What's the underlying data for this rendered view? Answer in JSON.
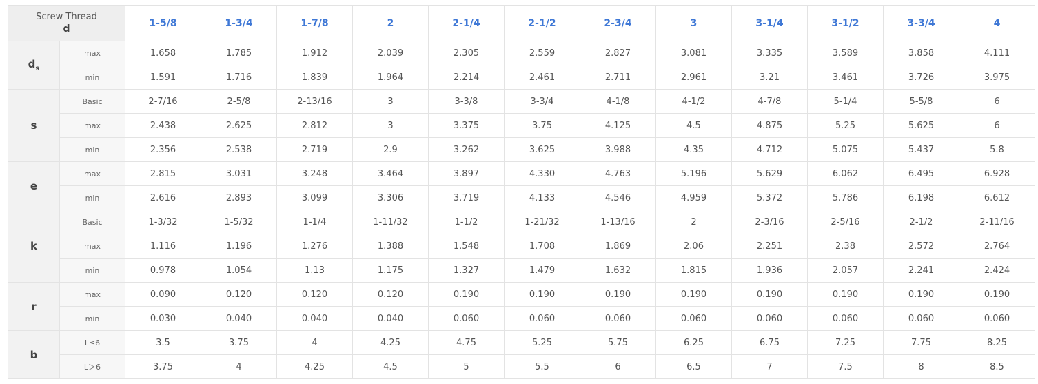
{
  "header": {
    "corner_line1": "Screw Thread",
    "corner_line2": "d",
    "sizes": [
      "1-5/8",
      "1-3/4",
      "1-7/8",
      "2",
      "2-1/4",
      "2-1/2",
      "2-3/4",
      "3",
      "3-1/4",
      "3-1/2",
      "3-3/4",
      "4"
    ]
  },
  "groups": [
    {
      "param": "d",
      "param_sub": "s",
      "rows": [
        {
          "label": "max",
          "values": [
            "1.658",
            "1.785",
            "1.912",
            "2.039",
            "2.305",
            "2.559",
            "2.827",
            "3.081",
            "3.335",
            "3.589",
            "3.858",
            "4.111"
          ]
        },
        {
          "label": "min",
          "values": [
            "1.591",
            "1.716",
            "1.839",
            "1.964",
            "2.214",
            "2.461",
            "2.711",
            "2.961",
            "3.21",
            "3.461",
            "3.726",
            "3.975"
          ]
        }
      ]
    },
    {
      "param": "s",
      "param_sub": "",
      "rows": [
        {
          "label": "Basic",
          "values": [
            "2-7/16",
            "2-5/8",
            "2-13/16",
            "3",
            "3-3/8",
            "3-3/4",
            "4-1/8",
            "4-1/2",
            "4-7/8",
            "5-1/4",
            "5-5/8",
            "6"
          ]
        },
        {
          "label": "max",
          "values": [
            "2.438",
            "2.625",
            "2.812",
            "3",
            "3.375",
            "3.75",
            "4.125",
            "4.5",
            "4.875",
            "5.25",
            "5.625",
            "6"
          ]
        },
        {
          "label": "min",
          "values": [
            "2.356",
            "2.538",
            "2.719",
            "2.9",
            "3.262",
            "3.625",
            "3.988",
            "4.35",
            "4.712",
            "5.075",
            "5.437",
            "5.8"
          ]
        }
      ]
    },
    {
      "param": "e",
      "param_sub": "",
      "rows": [
        {
          "label": "max",
          "values": [
            "2.815",
            "3.031",
            "3.248",
            "3.464",
            "3.897",
            "4.330",
            "4.763",
            "5.196",
            "5.629",
            "6.062",
            "6.495",
            "6.928"
          ]
        },
        {
          "label": "min",
          "values": [
            "2.616",
            "2.893",
            "3.099",
            "3.306",
            "3.719",
            "4.133",
            "4.546",
            "4.959",
            "5.372",
            "5.786",
            "6.198",
            "6.612"
          ]
        }
      ]
    },
    {
      "param": "k",
      "param_sub": "",
      "rows": [
        {
          "label": "Basic",
          "values": [
            "1-3/32",
            "1-5/32",
            "1-1/4",
            "1-11/32",
            "1-1/2",
            "1-21/32",
            "1-13/16",
            "2",
            "2-3/16",
            "2-5/16",
            "2-1/2",
            "2-11/16"
          ]
        },
        {
          "label": "max",
          "values": [
            "1.116",
            "1.196",
            "1.276",
            "1.388",
            "1.548",
            "1.708",
            "1.869",
            "2.06",
            "2.251",
            "2.38",
            "2.572",
            "2.764"
          ]
        },
        {
          "label": "min",
          "values": [
            "0.978",
            "1.054",
            "1.13",
            "1.175",
            "1.327",
            "1.479",
            "1.632",
            "1.815",
            "1.936",
            "2.057",
            "2.241",
            "2.424"
          ]
        }
      ]
    },
    {
      "param": "r",
      "param_sub": "",
      "rows": [
        {
          "label": "max",
          "values": [
            "0.090",
            "0.120",
            "0.120",
            "0.120",
            "0.190",
            "0.190",
            "0.190",
            "0.190",
            "0.190",
            "0.190",
            "0.190",
            "0.190"
          ]
        },
        {
          "label": "min",
          "values": [
            "0.030",
            "0.040",
            "0.040",
            "0.040",
            "0.060",
            "0.060",
            "0.060",
            "0.060",
            "0.060",
            "0.060",
            "0.060",
            "0.060"
          ]
        }
      ]
    },
    {
      "param": "b",
      "param_sub": "",
      "rows": [
        {
          "label": "L≤6",
          "values": [
            "3.5",
            "3.75",
            "4",
            "4.25",
            "4.75",
            "5.25",
            "5.75",
            "6.25",
            "6.75",
            "7.25",
            "7.75",
            "8.25"
          ]
        },
        {
          "label": "L＞6",
          "values": [
            "3.75",
            "4",
            "4.25",
            "4.5",
            "5",
            "5.5",
            "6",
            "6.5",
            "7",
            "7.5",
            "8",
            "8.5"
          ]
        }
      ]
    }
  ]
}
